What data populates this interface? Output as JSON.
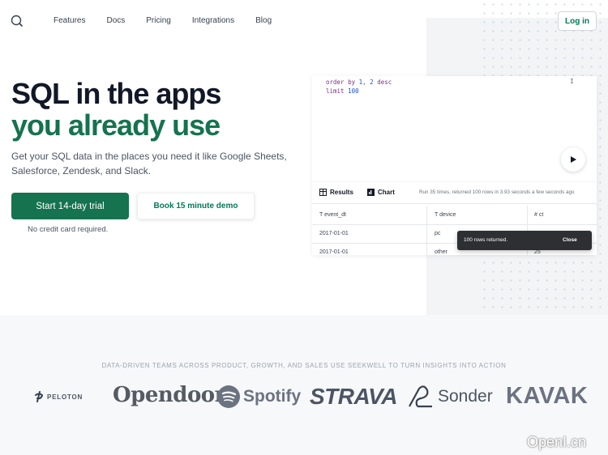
{
  "nav": {
    "items": [
      "Features",
      "Docs",
      "Pricing",
      "Integrations",
      "Blog"
    ],
    "login_label": "Log in"
  },
  "hero": {
    "title_line1": "SQL in the apps",
    "title_line2": "you already use",
    "lead": "Get your SQL data in the places you need it like Google Sheets, Salesforce, Zendesk, and Slack.",
    "primary_cta": "Start 14-day trial",
    "secondary_cta": "Book 15 minute demo",
    "note": "No credit card required."
  },
  "preview": {
    "code_line1_kw": "order by ",
    "code_line1_nums": "1, 2",
    "code_line1_end": " desc",
    "code_line2_kw": "limit ",
    "code_line2_num": "100",
    "cursor": "I",
    "tabs": {
      "results": "Results",
      "chart": "Chart"
    },
    "run_info": "Run 35 times, returned 100 rows in 3.93 seconds a few seconds ago",
    "columns": [
      "event_dt",
      "device",
      "ct"
    ],
    "column_type_icons": [
      "T",
      "T",
      "#"
    ],
    "rows": [
      [
        "2017-01-01",
        "pc",
        ""
      ],
      [
        "2017-01-01",
        "other",
        "25"
      ]
    ],
    "toast": {
      "message": "100 rows returned.",
      "close": "Close"
    }
  },
  "logos": {
    "caption": "DATA-DRIVEN TEAMS ACROSS PRODUCT, GROWTH, AND SALES USE SEEKWELL TO TURN INSIGHTS INTO ACTION",
    "brands": [
      "PELOTON",
      "Opendoor",
      "Spotify",
      "STRAVA",
      "Sonder",
      "KAVAK"
    ]
  },
  "watermark": "OpenI.cn",
  "colors": {
    "brand_green": "#15734f",
    "title": "#111827"
  }
}
